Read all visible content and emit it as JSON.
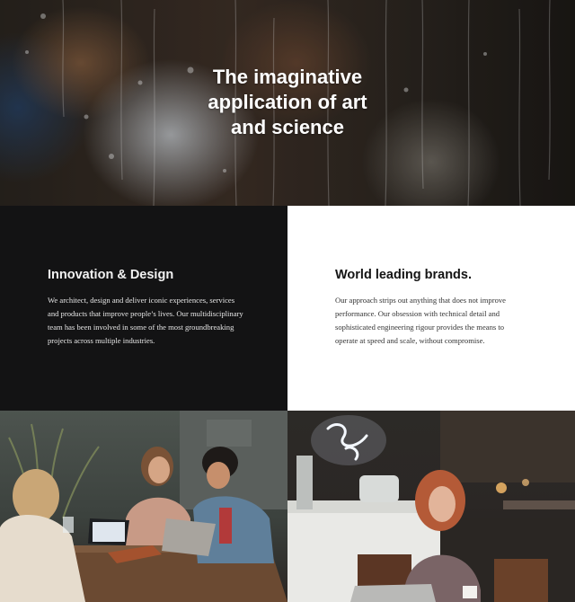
{
  "hero": {
    "title_line1": "The imaginative",
    "title_line2": "application of art",
    "title_line3": "and science"
  },
  "features": [
    {
      "heading": "Innovation & Design",
      "body": "We architect, design and deliver iconic experiences, services and products that improve people’s lives. Our multidisciplinary team has been involved in some of the most groundbreaking projects across multiple industries."
    },
    {
      "heading": "World leading brands.",
      "body": "Our approach strips out anything that does not improve performance. Our obsession with technical detail and sophisticated engineering rigour provides the means to operate at speed and scale, without compromise."
    }
  ],
  "theme": {
    "dark_panel": "#131314",
    "light_panel": "#ffffff",
    "hero_text": "#ffffff"
  }
}
